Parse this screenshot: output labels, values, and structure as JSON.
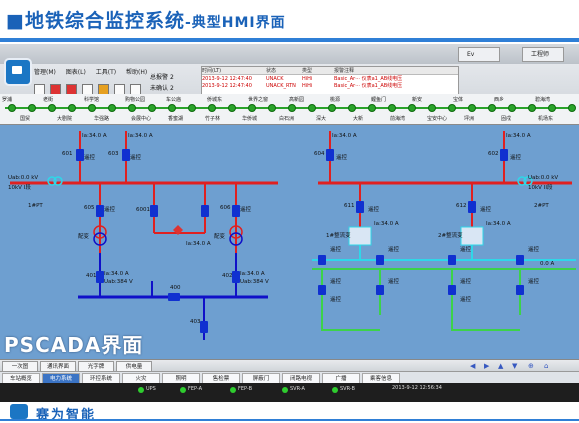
{
  "slide": {
    "title_main": "■地铁综合监控系统",
    "title_sub": "-典型HMI界面",
    "overlay_label": "PSCADA界面",
    "company": "赛为智能"
  },
  "window": {
    "tab_left": "Ev",
    "tab_right": "工程师"
  },
  "menu": {
    "items": [
      "管理(M)",
      "图表(L)",
      "工具(T)",
      "帮助(H)"
    ]
  },
  "counts": {
    "alarm_total_label": "总报警",
    "alarm_total_value": "2",
    "unconfirmed_label": "未确认",
    "unconfirmed_value": "2"
  },
  "alarm_list": {
    "headers": [
      "时间(LT)",
      "状态",
      "类型",
      "报警注释"
    ],
    "rows": [
      [
        "2013-9-12 12:47:40",
        "UNACK",
        "HiHi",
        "Basic_Ar··· 仪表a1_AB线电压"
      ],
      [
        "2013-9-12 12:47:40",
        "UNACK_RTN",
        "HiHi",
        "Basic_Ar··· 仪表a1_AB线电压"
      ]
    ]
  },
  "stations_top": [
    "罗浦",
    "老街",
    "科学馆",
    "购物公园",
    "车公庙",
    "侨城东",
    "世界之窗",
    "高新园",
    "桃源",
    "鲤鱼门",
    "新安",
    "宝体",
    "西乡",
    "碧海湾"
  ],
  "stations_bottom": [
    "国贸",
    "大剧院",
    "华强路",
    "会展中心",
    "香蜜湖",
    "竹子林",
    "华侨城",
    "白石洲",
    "深大",
    "大新",
    "前海湾",
    "宝安中心",
    "坪洲",
    "固戍",
    "机场东"
  ],
  "diagram": {
    "bus_label_left": "Uab:0.0 kV",
    "bus_label_right": "Uab:0.0 kV",
    "line_left": "10kV I段",
    "line_right": "10kV II段",
    "breakers_top": [
      "601",
      "603",
      "604",
      "602"
    ],
    "breakers_mid": [
      "605",
      "6001",
      "606",
      "611",
      "612"
    ],
    "breakers_low": [
      "401",
      "400",
      "402",
      "403"
    ],
    "current_reading": "Ia:34.0 A",
    "voltage_reading": "Uab:384 V",
    "pt_left": "1#PT",
    "pt_right": "2#PT",
    "transformer_label": "配变",
    "remote_label": "遥控",
    "transformer_left": "1#整流变",
    "transformer_right": "2#整流变",
    "zero_reading": "0.0 A"
  },
  "nav_buttons": [
    "一次图",
    "通讯界面",
    "光字牌",
    "供电量"
  ],
  "system_buttons": [
    "车站概览",
    "电力系统",
    "环控系统",
    "火灾",
    "照明",
    "售检票",
    "屏蔽门",
    "闭路电视",
    "广播",
    "乘客信息"
  ],
  "active_system": "电力系统",
  "status_bar": {
    "items": [
      "UPS",
      "FEP-A",
      "FEP-B",
      "SVR-A",
      "SVR-B"
    ],
    "time": "2013-9-12 12:56:34"
  },
  "colors": {
    "bus_red": "#e02020",
    "bus_blue": "#1010c8",
    "bus_cyan": "#2fd7e8",
    "bus_green": "#3cd24a",
    "screen_bg": "#6e9fd0",
    "accent": "#1a62b8"
  }
}
